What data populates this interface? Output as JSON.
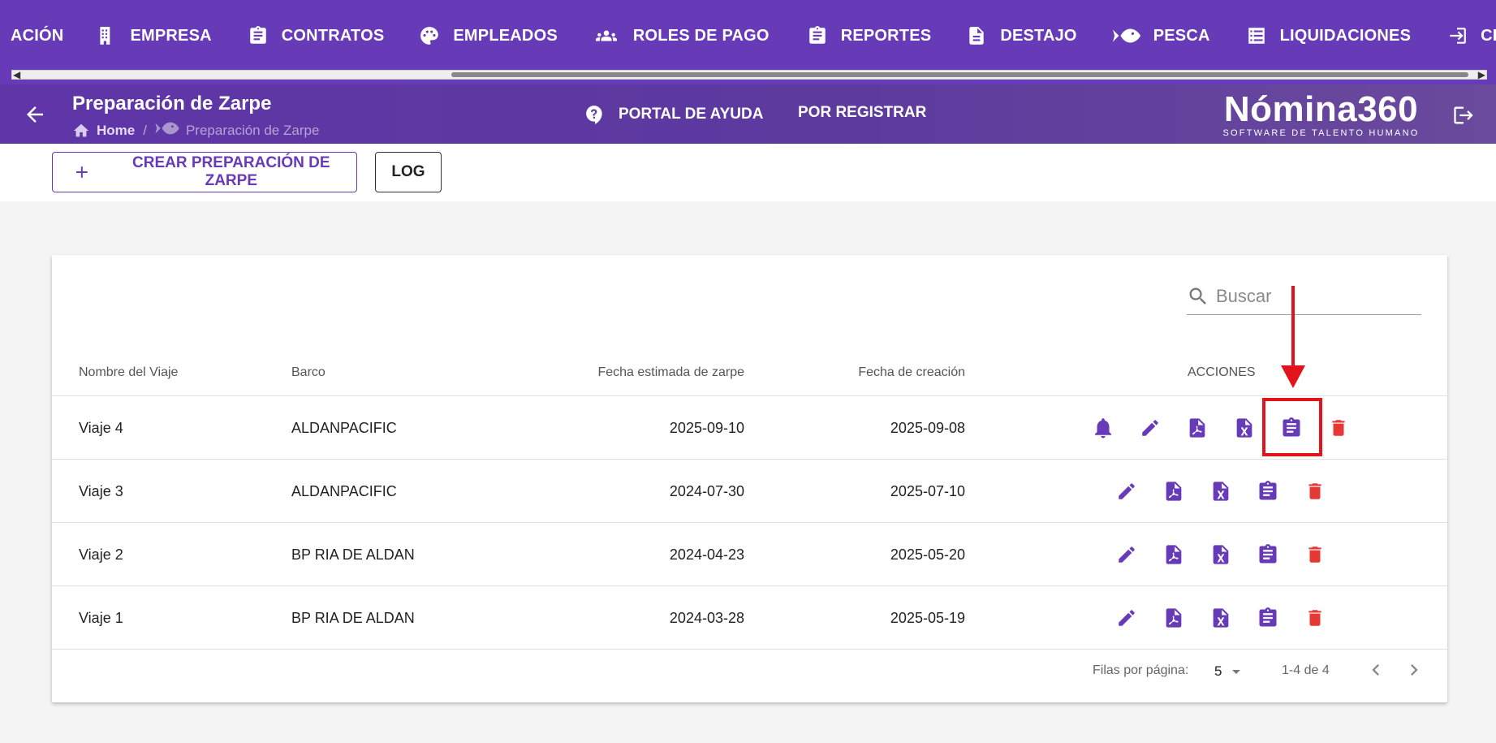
{
  "topnav": {
    "items": [
      {
        "label": "ACIÓN",
        "icon": "none"
      },
      {
        "label": "EMPRESA",
        "icon": "building-icon"
      },
      {
        "label": "CONTRATOS",
        "icon": "clipboard-icon"
      },
      {
        "label": "EMPLEADOS",
        "icon": "palette-icon"
      },
      {
        "label": "ROLES DE PAGO",
        "icon": "users-icon"
      },
      {
        "label": "REPORTES",
        "icon": "clipboard-icon"
      },
      {
        "label": "DESTAJO",
        "icon": "document-icon"
      },
      {
        "label": "PESCA",
        "icon": "fish-icon"
      },
      {
        "label": "LIQUIDACIONES",
        "icon": "list-icon"
      },
      {
        "label": "CERRAR SESIÓN",
        "icon": "logout-icon"
      }
    ]
  },
  "appbar": {
    "title": "Preparación de Zarpe",
    "breadcrumb": {
      "home": "Home",
      "separator": "/",
      "current": "Preparación de Zarpe"
    },
    "help_label": "PORTAL DE AYUDA",
    "register_label": "POR REGISTRAR",
    "brand_name": "Nómina360",
    "brand_tagline": "SOFTWARE DE TALENTO HUMANO"
  },
  "toolbar": {
    "create_label": "CREAR PREPARACIÓN DE ZARPE",
    "log_label": "LOG"
  },
  "search": {
    "placeholder": "Buscar"
  },
  "table": {
    "headers": {
      "name": "Nombre del Viaje",
      "boat": "Barco",
      "est_date": "Fecha estimada de zarpe",
      "created": "Fecha de creación",
      "actions": "ACCIONES"
    },
    "rows": [
      {
        "name": "Viaje 4",
        "boat": "ALDANPACIFIC",
        "est_date": "2025-09-10",
        "created": "2025-09-08",
        "has_notification": true
      },
      {
        "name": "Viaje 3",
        "boat": "ALDANPACIFIC",
        "est_date": "2024-07-30",
        "created": "2025-07-10",
        "has_notification": false
      },
      {
        "name": "Viaje 2",
        "boat": "BP RIA DE ALDAN",
        "est_date": "2024-04-23",
        "created": "2025-05-20",
        "has_notification": false
      },
      {
        "name": "Viaje 1",
        "boat": "BP RIA DE ALDAN",
        "est_date": "2024-03-28",
        "created": "2025-05-19",
        "has_notification": false
      }
    ],
    "row_actions": [
      "bell-icon",
      "pencil-icon",
      "pdf-icon",
      "excel-icon",
      "clipboard-icon",
      "trash-icon"
    ]
  },
  "pagination": {
    "rows_per_page_label": "Filas por página:",
    "rows_per_page": "5",
    "range": "1-4 de 4"
  },
  "colors": {
    "primary": "#673ab7",
    "danger": "#e53935",
    "annotation": "#e3131b"
  }
}
